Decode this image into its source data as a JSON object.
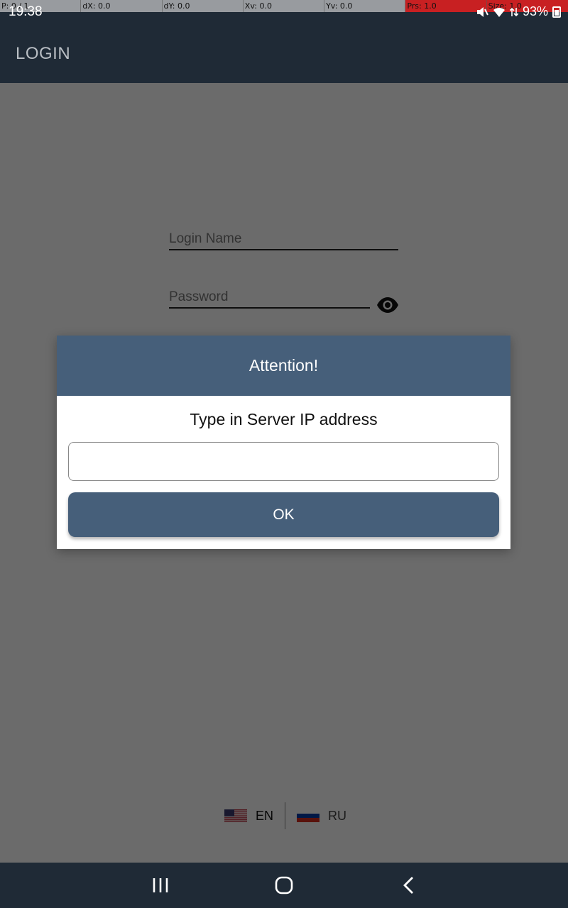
{
  "pointer_overlay": {
    "cells": [
      "P: 0 / 1",
      "dX: 0.0",
      "dY: 0.0",
      "Xv: 0.0",
      "Yv: 0.0",
      "Prs: 1.0",
      "Size: 1.0"
    ],
    "highlight_color": "#e61e1e"
  },
  "status_bar": {
    "time": "19:38",
    "battery": "93%",
    "icons": [
      "mute-icon",
      "wifi-icon",
      "data-arrows-icon",
      "battery-icon"
    ]
  },
  "app_bar": {
    "title": "LOGIN"
  },
  "login_form": {
    "login_placeholder": "Login Name",
    "password_placeholder": "Password",
    "password_toggle_icon": "eye-icon"
  },
  "language_switch": {
    "languages": [
      {
        "code": "EN",
        "flag": "us-flag-icon"
      },
      {
        "code": "RU",
        "flag": "ru-flag-icon"
      }
    ]
  },
  "dialog": {
    "title": "Attention!",
    "message": "Type in Server IP address",
    "input_value": "",
    "ok_label": "OK"
  },
  "nav_bar": {
    "buttons": [
      "recent-apps-icon",
      "home-icon",
      "back-icon"
    ]
  },
  "colors": {
    "dark_bar": "#1f2a36",
    "dialog_accent": "#465f7a",
    "scrim": "rgba(0,0,0,0.58)"
  }
}
